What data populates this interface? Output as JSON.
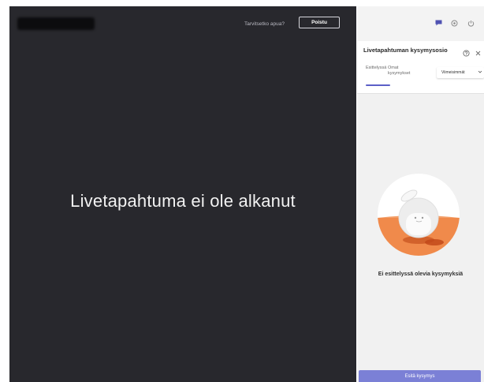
{
  "stage": {
    "help_link": "Tarvitsetko apua?",
    "leave_label": "Poistu",
    "message": "Livetapahtuma ei ole alkanut"
  },
  "topbar_icons": [
    "chat-icon",
    "settings-icon",
    "power-icon"
  ],
  "panel": {
    "title": "Livetapahtuman kysymysosio",
    "tabs": [
      {
        "label": "Esittelyssä",
        "active": true
      },
      {
        "label": "Omat kysymykset",
        "active": false
      }
    ],
    "sort": {
      "selected": "Viimeisimmät"
    },
    "empty_message": "Ei esittelyssä olevia kysymyksiä",
    "ask_label": "Esitä kysymys"
  },
  "colors": {
    "stage_bg": "#28282d",
    "panel_bg": "#f1f1f1",
    "accent": "#5b5fc7",
    "illustration_orange": "#f08a4b"
  }
}
